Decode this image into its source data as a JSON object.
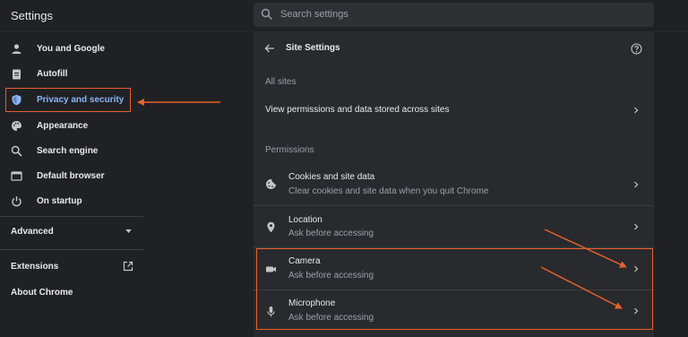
{
  "app": {
    "title": "Settings"
  },
  "search": {
    "placeholder": "Search settings",
    "icon": "search-icon"
  },
  "sidebar": {
    "items": [
      {
        "label": "You and Google",
        "icon": "person-icon"
      },
      {
        "label": "Autofill",
        "icon": "clipboard-icon"
      },
      {
        "label": "Privacy and security",
        "icon": "shield-icon",
        "active": true
      },
      {
        "label": "Appearance",
        "icon": "palette-icon"
      },
      {
        "label": "Search engine",
        "icon": "search-icon"
      },
      {
        "label": "Default browser",
        "icon": "browser-icon"
      },
      {
        "label": "On startup",
        "icon": "power-icon"
      }
    ],
    "advanced": {
      "label": "Advanced",
      "icon": "caret-down-icon"
    },
    "extensions": {
      "label": "Extensions",
      "icon": "external-link-icon"
    },
    "about": {
      "label": "About Chrome"
    }
  },
  "main": {
    "title": "Site Settings",
    "all_sites_label": "All sites",
    "view_permissions": "View permissions and data stored across sites",
    "permissions_label": "Permissions",
    "permissions": [
      {
        "title": "Cookies and site data",
        "subtitle": "Clear cookies and site data when you quit Chrome",
        "icon": "cookie-icon"
      },
      {
        "title": "Location",
        "subtitle": "Ask before accessing",
        "icon": "location-pin-icon"
      },
      {
        "title": "Camera",
        "subtitle": "Ask before accessing",
        "icon": "camera-icon"
      },
      {
        "title": "Microphone",
        "subtitle": "Ask before accessing",
        "icon": "microphone-icon"
      }
    ]
  },
  "colors": {
    "background": "#202124",
    "card": "#292a2d",
    "accent": "#8ab4f8",
    "annotation": "#e8602c"
  }
}
